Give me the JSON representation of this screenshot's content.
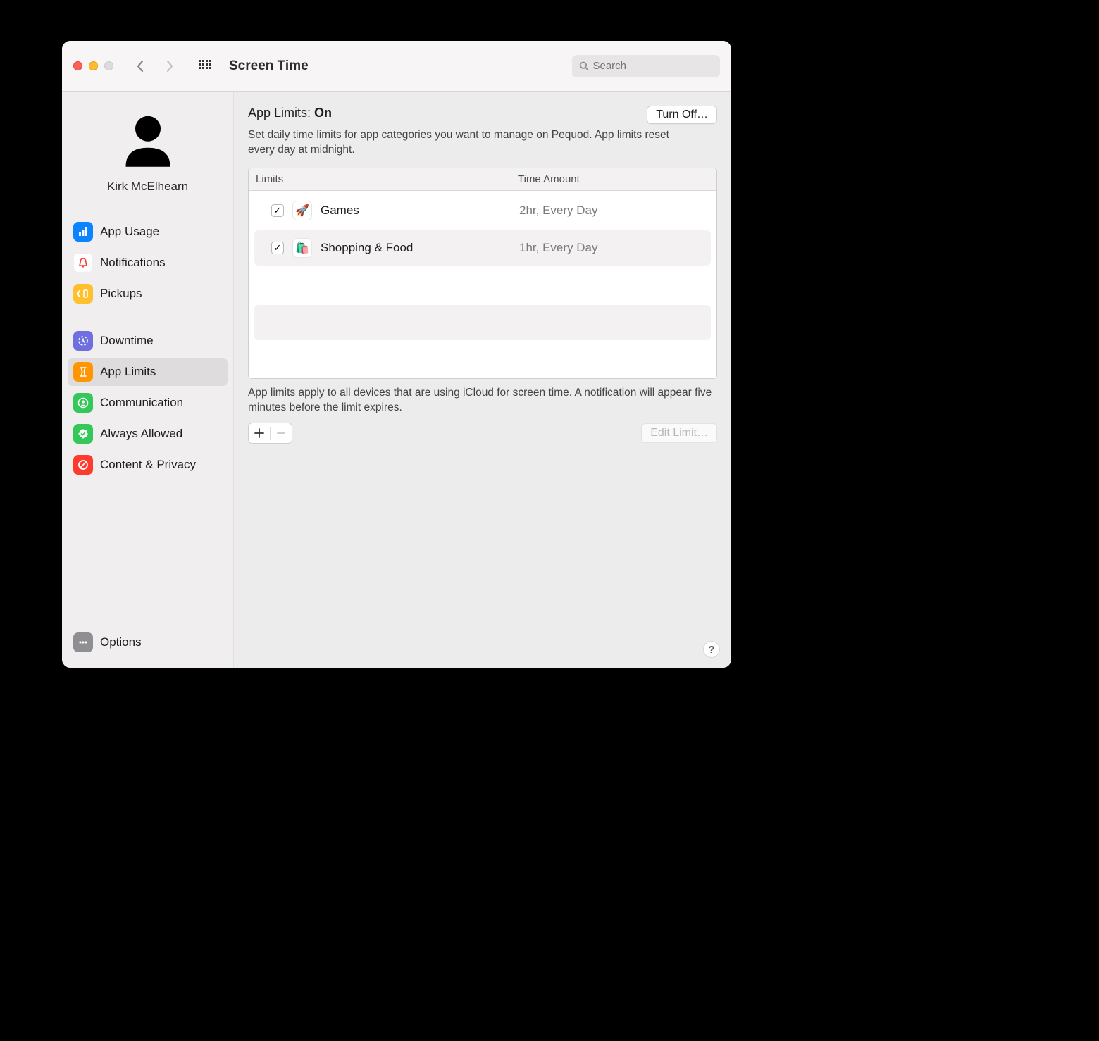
{
  "toolbar": {
    "title": "Screen Time",
    "search_placeholder": "Search"
  },
  "sidebar": {
    "username": "Kirk McElhearn",
    "items_top": [
      {
        "name": "app-usage",
        "label": "App Usage",
        "icon_bg": "#0a84ff"
      },
      {
        "name": "notifications",
        "label": "Notifications",
        "icon_bg": "#ffffff"
      },
      {
        "name": "pickups",
        "label": "Pickups",
        "icon_bg": "#ffc02e"
      }
    ],
    "items_mid": [
      {
        "name": "downtime",
        "label": "Downtime",
        "icon_bg": "#6f6fdf"
      },
      {
        "name": "app-limits",
        "label": "App Limits",
        "icon_bg": "#ff9500",
        "selected": true
      },
      {
        "name": "communication",
        "label": "Communication",
        "icon_bg": "#34c759"
      },
      {
        "name": "always-allowed",
        "label": "Always Allowed",
        "icon_bg": "#34c759"
      },
      {
        "name": "content-privacy",
        "label": "Content & Privacy",
        "icon_bg": "#ff3b30"
      }
    ],
    "options_label": "Options"
  },
  "content": {
    "title_prefix": "App Limits: ",
    "title_state": "On",
    "turn_off_label": "Turn Off…",
    "subtitle": "Set daily time limits for app categories you want to manage on Pequod. App limits reset every day at midnight.",
    "col_limits": "Limits",
    "col_time": "Time Amount",
    "rows": [
      {
        "checked": true,
        "icon": "🚀",
        "name": "Games",
        "time": "2hr, Every Day"
      },
      {
        "checked": true,
        "icon": "🛍️",
        "name": "Shopping & Food",
        "time": "1hr, Every Day"
      }
    ],
    "note": "App limits apply to all devices that are using iCloud for screen time. A notification will appear five minutes before the limit expires.",
    "edit_label": "Edit Limit…",
    "help_label": "?"
  }
}
